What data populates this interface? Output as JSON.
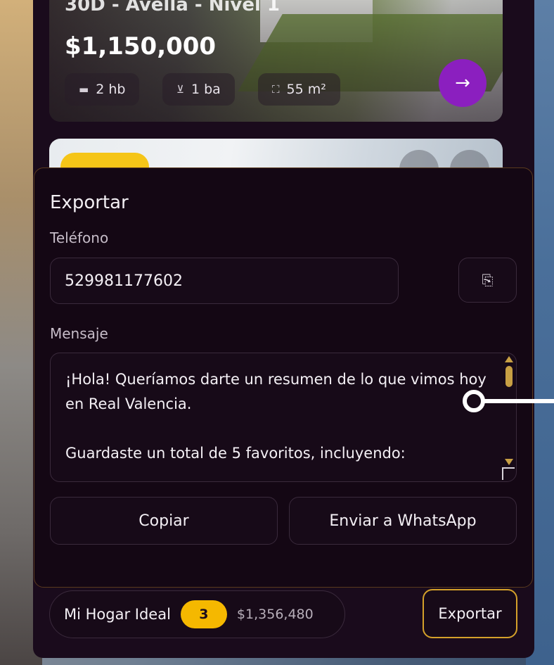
{
  "listing1": {
    "title": "30D - Avella - Nivel 1",
    "price": "$1,150,000",
    "beds": "2 hb",
    "baths": "1 ba",
    "area": "55 m²"
  },
  "export_sheet": {
    "title": "Exportar",
    "phone_label": "Teléfono",
    "phone_value": "529981177602",
    "message_label": "Mensaje",
    "message_text": "¡Hola! Queríamos darte un resumen de lo que vimos hoy en Real Valencia.\n\nGuardaste un total de 5 favoritos, incluyendo:",
    "copy_button": "Copiar",
    "whatsapp_button": "Enviar a WhatsApp"
  },
  "bottom_bar": {
    "list_name": "Mi Hogar Ideal",
    "count": "3",
    "total": "$1,356,480",
    "export_button": "Exportar"
  },
  "colors": {
    "accent_purple": "#8b1fbf",
    "accent_gold": "#f5b800",
    "panel_bg": "#140714"
  },
  "icons": {
    "bed": "bed-icon",
    "bath": "bath-icon",
    "area": "area-icon",
    "arrow": "arrow-right-icon",
    "copy": "copy-icon"
  }
}
